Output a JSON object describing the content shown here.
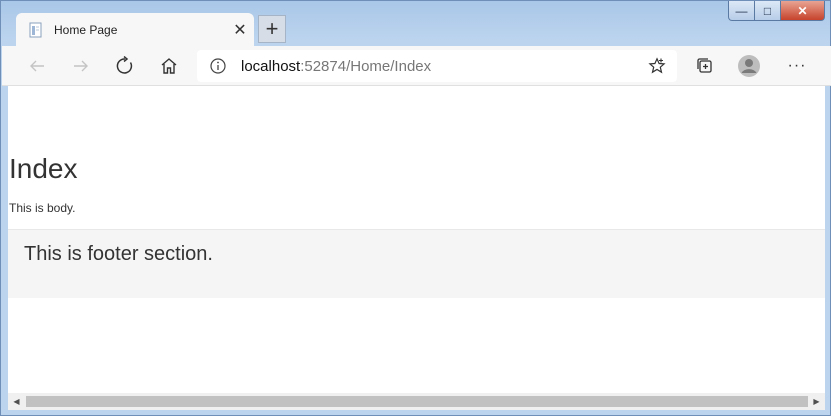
{
  "tab": {
    "title": "Home Page",
    "close_glyph": "✕"
  },
  "new_tab": {
    "glyph": "+"
  },
  "window_controls": {
    "minimize": "—",
    "maximize": "□",
    "close": "✕"
  },
  "toolbar": {
    "more_glyph": "···"
  },
  "address": {
    "host": "localhost",
    "path": ":52874/Home/Index"
  },
  "page": {
    "title": "Index",
    "body": "This is body.",
    "footer": "This is footer section."
  },
  "scrollbar": {
    "left_arrow": "◀",
    "right_arrow": "▶"
  }
}
